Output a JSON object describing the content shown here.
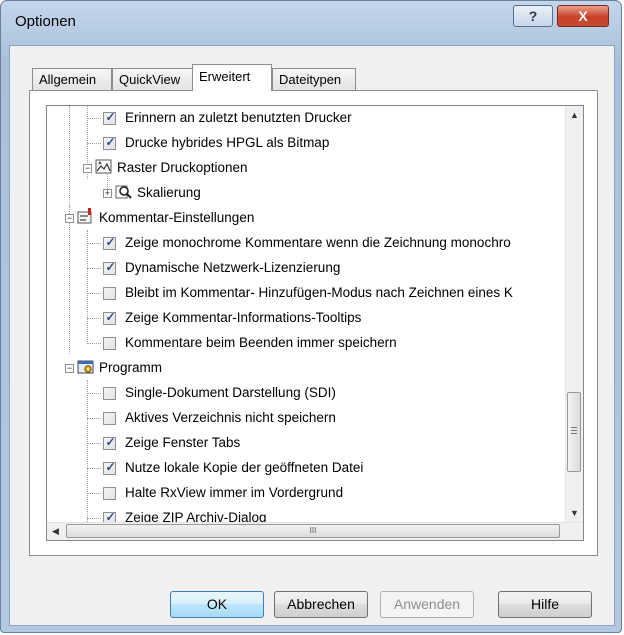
{
  "window": {
    "title": "Optionen",
    "help_glyph": "?",
    "close_glyph": "X"
  },
  "tabs": [
    {
      "label": "Allgemein"
    },
    {
      "label": "QuickView"
    },
    {
      "label": "Erweitert"
    },
    {
      "label": "Dateitypen"
    }
  ],
  "tree": {
    "items": [
      {
        "label": "Erinnern an zuletzt benutzten Drucker",
        "checked": true
      },
      {
        "label": "Drucke hybrides HPGL als Bitmap",
        "checked": true
      },
      {
        "label": "Raster Druckoptionen",
        "expander": "−",
        "icon": "raster-print-icon"
      },
      {
        "label": "Skalierung",
        "expander": "+",
        "icon": "scaling-magnifier-icon"
      },
      {
        "label": "Kommentar-Einstellungen",
        "expander": "−",
        "icon": "comment-settings-icon"
      },
      {
        "label": "Zeige monochrome Kommentare wenn die Zeichnung monochro",
        "checked": true
      },
      {
        "label": "Dynamische Netzwerk-Lizenzierung",
        "checked": true
      },
      {
        "label": "Bleibt im Kommentar- Hinzufügen-Modus nach Zeichnen eines K",
        "checked": false
      },
      {
        "label": "Zeige Kommentar-Informations-Tooltips",
        "checked": true
      },
      {
        "label": "Kommentare beim Beenden immer speichern",
        "checked": false
      },
      {
        "label": "Programm",
        "expander": "−",
        "icon": "program-settings-icon"
      },
      {
        "label": "Single-Dokument Darstellung (SDI)",
        "checked": false
      },
      {
        "label": "Aktives Verzeichnis nicht speichern",
        "checked": false
      },
      {
        "label": "Zeige Fenster Tabs",
        "checked": true
      },
      {
        "label": "Nutze lokale Kopie der geöffneten Datei",
        "checked": true
      },
      {
        "label": "Halte RxView immer im Vordergrund",
        "checked": false
      },
      {
        "label": "Zeige ZIP Archiv-Dialog",
        "checked": true
      }
    ],
    "hscroll_grip": "III"
  },
  "buttons": {
    "ok": "OK",
    "cancel": "Abbrechen",
    "apply": "Anwenden",
    "help": "Hilfe"
  },
  "colors": {
    "check": "#2b4f8a",
    "title_bg": "#b7cbe3",
    "close": "#c9402a"
  }
}
